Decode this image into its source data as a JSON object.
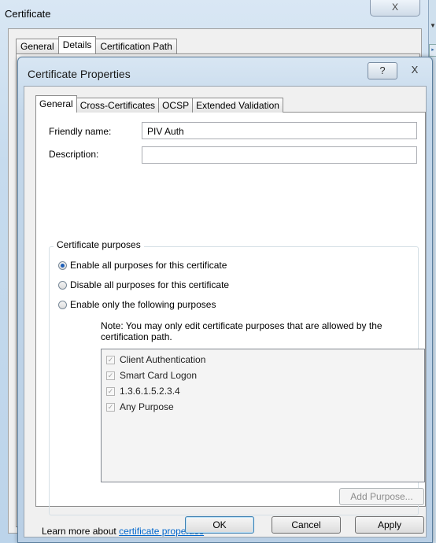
{
  "outer_window": {
    "title": "Certificate",
    "close_glyph": "X",
    "tabs": [
      "General",
      "Details",
      "Certification Path"
    ],
    "active_tab": "Details"
  },
  "dialog": {
    "title": "Certificate Properties",
    "help_glyph": "?",
    "close_glyph": "X",
    "tabs": [
      "General",
      "Cross-Certificates",
      "OCSP",
      "Extended Validation"
    ],
    "active_tab": "General",
    "friendly_name_label": "Friendly name:",
    "friendly_name_value": "PIV Auth",
    "description_label": "Description:",
    "description_value": "",
    "purposes_group_label": "Certificate purposes",
    "radio_options": [
      {
        "label": "Enable all purposes for this certificate",
        "selected": true
      },
      {
        "label": "Disable all purposes for this certificate",
        "selected": false
      },
      {
        "label": "Enable only the following purposes",
        "selected": false
      }
    ],
    "note": "Note: You may only edit certificate purposes that are allowed by the certification path.",
    "purposes": [
      {
        "label": "Client Authentication",
        "checked": true
      },
      {
        "label": "Smart Card Logon",
        "checked": true
      },
      {
        "label": "1.3.6.1.5.2.3.4",
        "checked": true
      },
      {
        "label": "Any Purpose",
        "checked": true
      }
    ],
    "add_purpose_button": "Add Purpose...",
    "learn_more_prefix": "Learn more about ",
    "learn_more_link": "certificate properties",
    "ok_button": "OK",
    "cancel_button": "Cancel",
    "apply_button": "Apply"
  },
  "colors": {
    "link": "#0066cc",
    "radio_selected": "#1d5fb8",
    "title_bar": "#c3d7ea"
  }
}
